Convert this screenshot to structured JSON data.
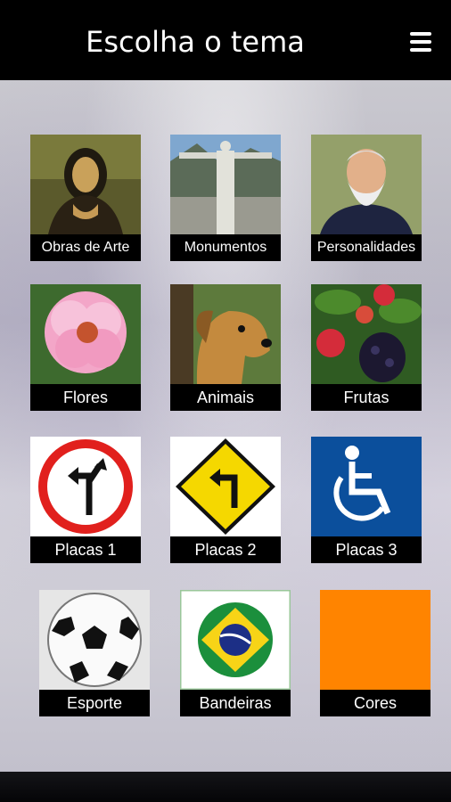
{
  "header": {
    "title": "Escolha o tema",
    "menu_icon": "hamburger-menu-icon"
  },
  "themes": [
    {
      "label": "Obras de Arte",
      "icon": "mona-lisa-painting"
    },
    {
      "label": "Monumentos",
      "icon": "christ-the-redeemer-statue"
    },
    {
      "label": "Personalidades",
      "icon": "bearded-emperor-portrait"
    },
    {
      "label": "Flores",
      "icon": "pink-rose"
    },
    {
      "label": "Animais",
      "icon": "dog"
    },
    {
      "label": "Frutas",
      "icon": "berries"
    },
    {
      "label": "Placas 1",
      "icon": "no-left-turn-sign"
    },
    {
      "label": "Placas 2",
      "icon": "left-turn-warning-sign"
    },
    {
      "label": "Placas 3",
      "icon": "wheelchair-sign"
    },
    {
      "label": "Esporte",
      "icon": "soccer-ball"
    },
    {
      "label": "Bandeiras",
      "icon": "brazil-flag-ball"
    },
    {
      "label": "Cores",
      "icon": "orange-color-square"
    }
  ],
  "colors": {
    "header_bg": "#000000",
    "label_bg": "#000000",
    "label_text": "#ffffff",
    "sign_blue": "#0b4f9c",
    "sign_yellow": "#f5d800",
    "sign_red": "#e1201d",
    "cores_orange": "#ff8400"
  }
}
